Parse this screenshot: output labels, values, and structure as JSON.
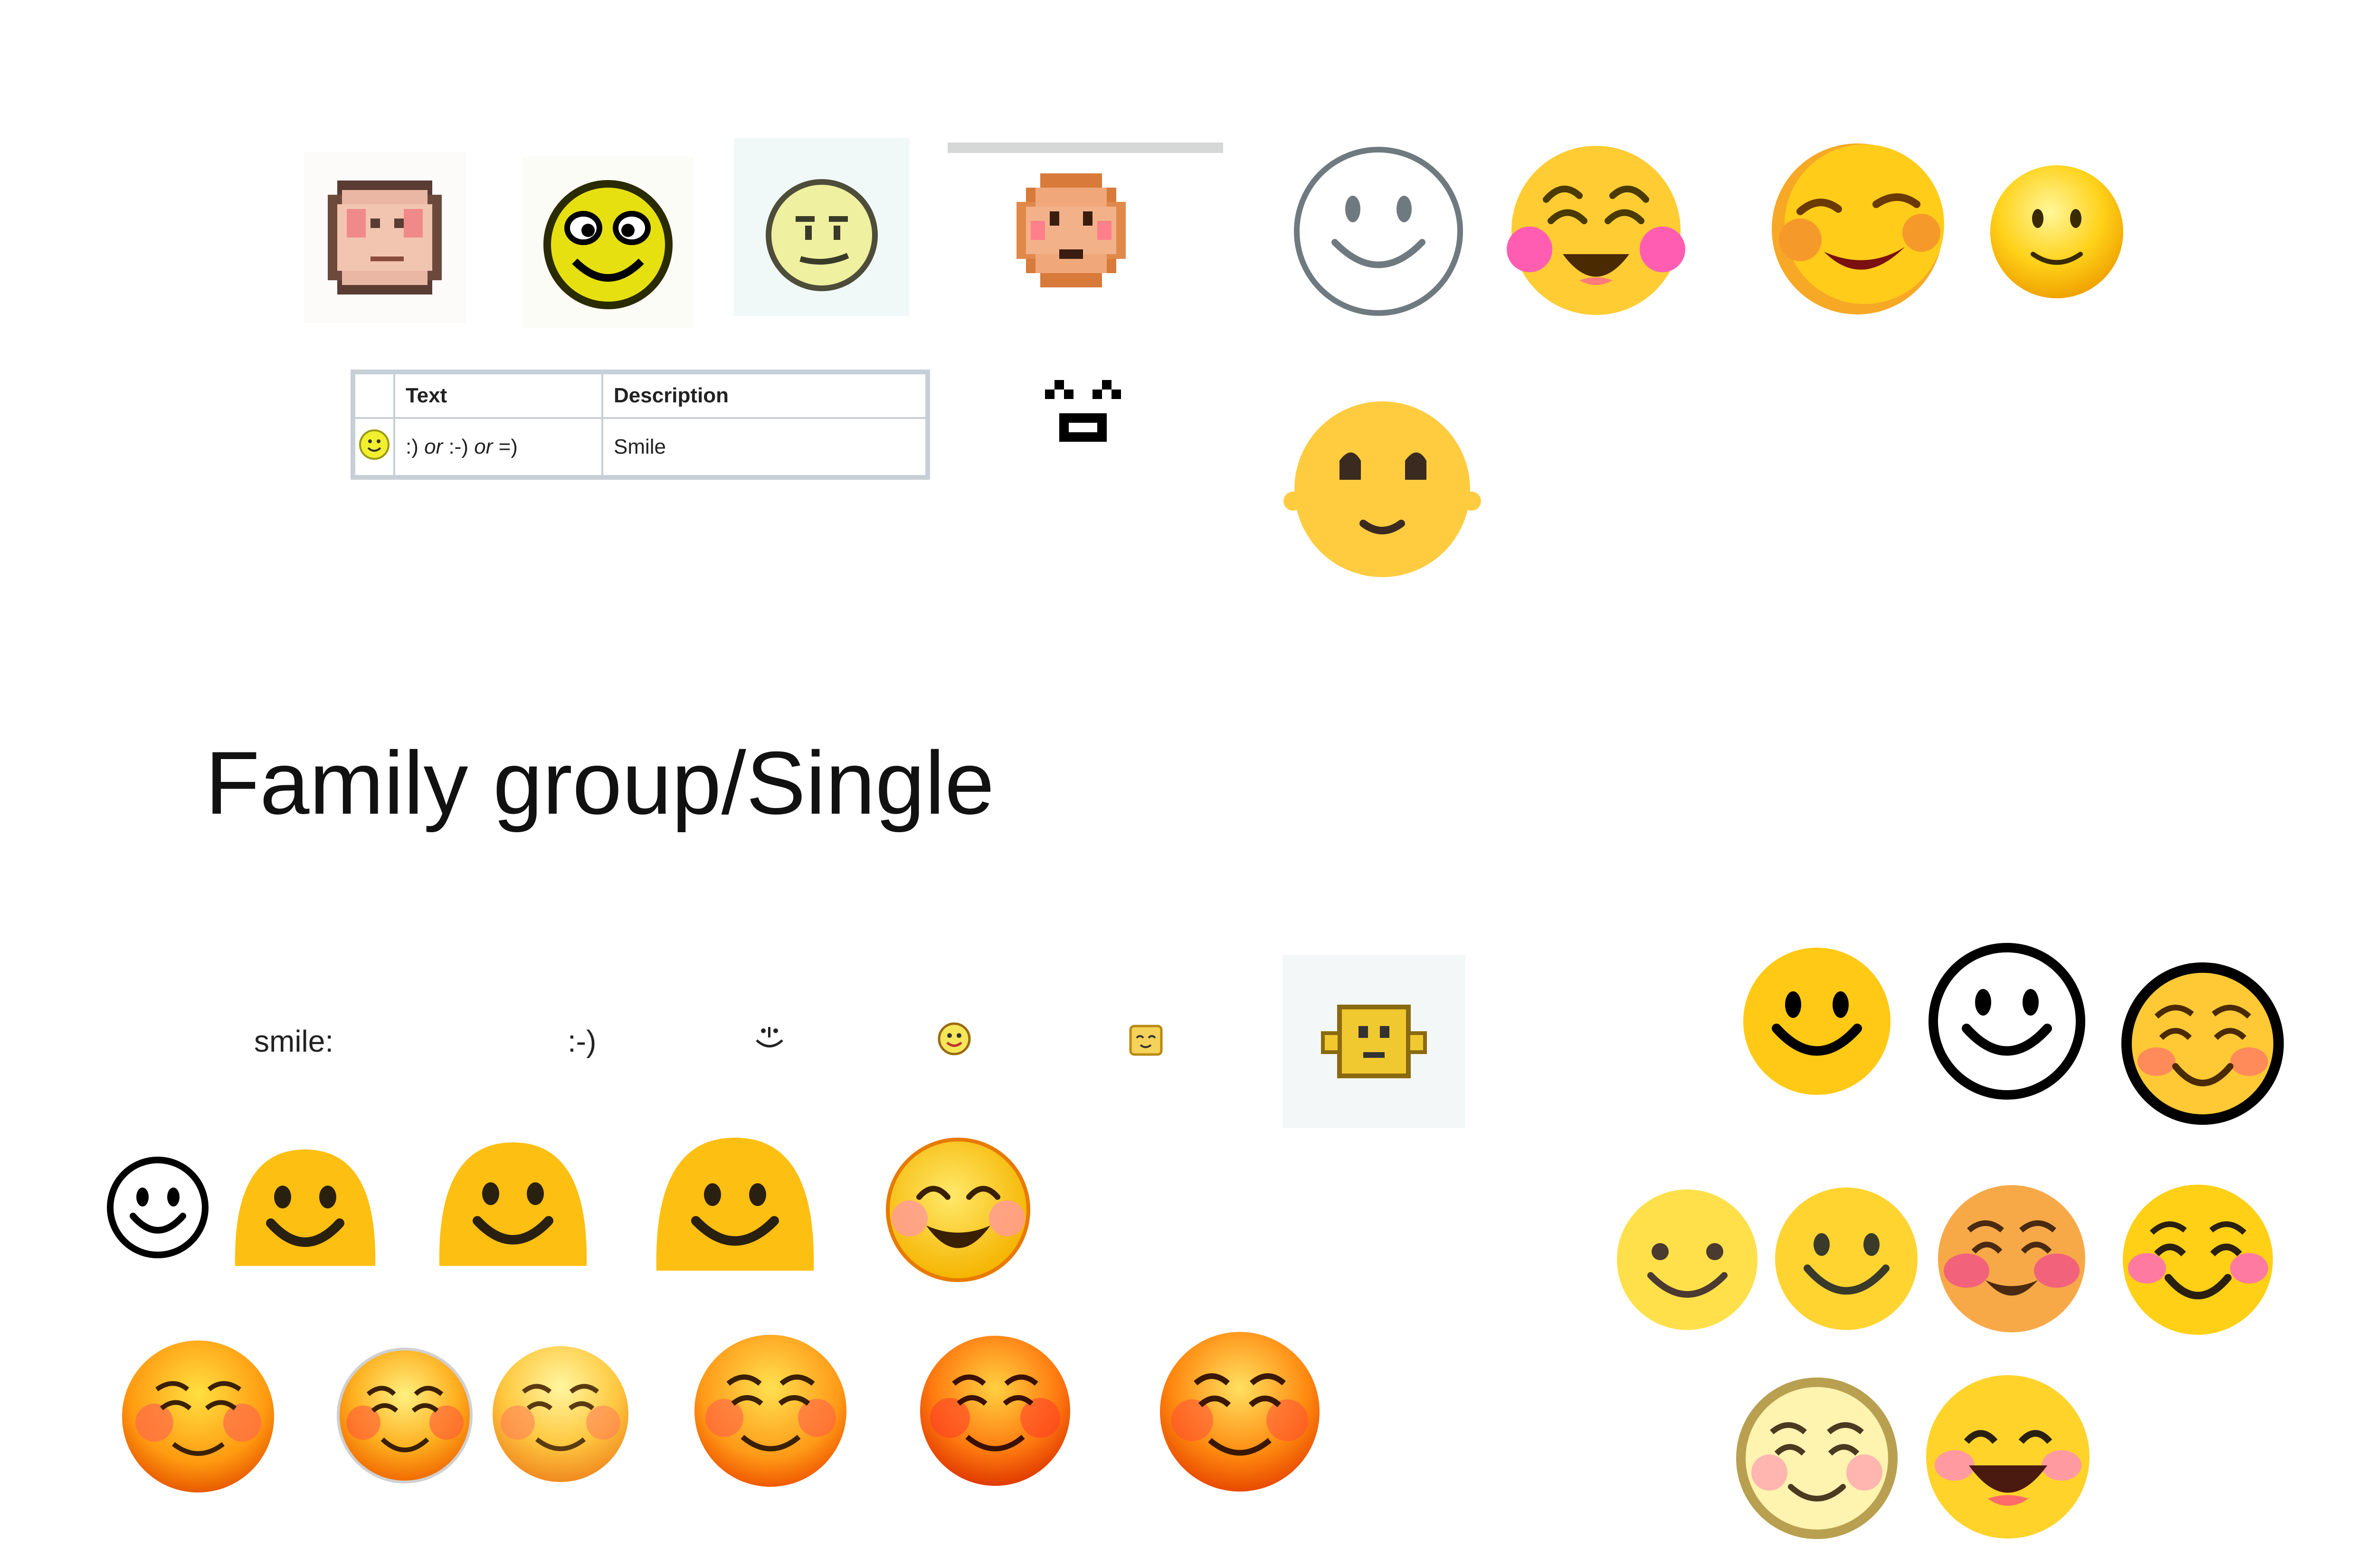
{
  "heading": "Family group/Single",
  "table": {
    "headers": [
      "",
      "Text",
      "Description"
    ],
    "row": {
      "text_parts": [
        ":) ",
        "or",
        " :-) ",
        "or",
        " =)"
      ],
      "description": "Smile"
    }
  },
  "shortcodes": {
    "smile_colon": "smile:",
    "ascii_smile": ":-)"
  },
  "icons": [
    "pixel-tan-face-icon",
    "pixel-yellow-grin-icon",
    "pixel-pale-smirk-icon",
    "pixel-orange-face-icon",
    "outline-smile-icon",
    "blush-smile-icon",
    "tilted-blush-smile-icon",
    "glossy-smile-icon",
    "text-face-icon",
    "round-eyes-smile-icon",
    "blob-smile-icon",
    "relaxed-face-icon"
  ],
  "colors": {
    "yellow": "#FFCC33",
    "orange": "#F5A623",
    "blush": "#FF6F91",
    "outline": "#000000",
    "table_border": "#c7cfd6"
  }
}
